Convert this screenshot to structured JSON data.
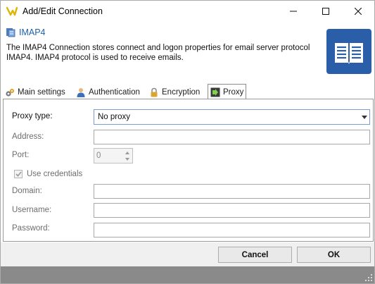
{
  "window": {
    "title": "Add/Edit Connection",
    "controls": [
      "minimize-icon",
      "maximize-icon",
      "close-icon"
    ]
  },
  "header": {
    "title": "IMAP4",
    "description": "The IMAP4 Connection stores connect and logon properties for email server protocol IMAP4. IMAP4 protocol is used to receive emails.",
    "icon": "book-icon",
    "accent_color": "#2b5ea8"
  },
  "tabs": [
    {
      "label": "Main settings",
      "icon": "gear-icon"
    },
    {
      "label": "Authentication",
      "icon": "user-icon"
    },
    {
      "label": "Encryption",
      "icon": "lock-icon"
    },
    {
      "label": "Proxy",
      "icon": "proxy-icon",
      "active": true
    }
  ],
  "proxy": {
    "type_label": "Proxy type:",
    "type_value": "No proxy",
    "address_label": "Address:",
    "address_value": "",
    "port_label": "Port:",
    "port_value": "0",
    "use_credentials_label": "Use credentials",
    "use_credentials_checked": true,
    "domain_label": "Domain:",
    "domain_value": "",
    "username_label": "Username:",
    "username_value": "",
    "password_label": "Password:",
    "password_value": ""
  },
  "buttons": {
    "cancel": "Cancel",
    "ok": "OK"
  }
}
